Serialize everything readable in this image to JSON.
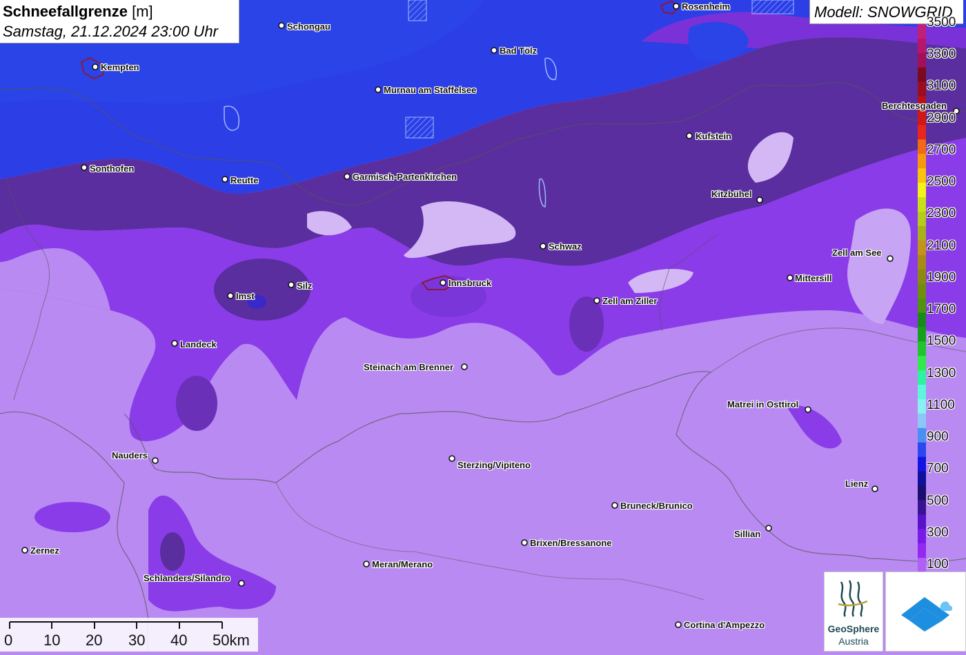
{
  "title": {
    "main": "Schneefallgrenze",
    "unit": "[m]",
    "date": "Samstag, 21.12.2024 23:00 Uhr"
  },
  "model_label": "Modell: SNOWGRID",
  "cities": [
    {
      "name": "Schongau",
      "label": "Schongau"
    },
    {
      "name": "Rosenheim",
      "label": "Rosenheim"
    },
    {
      "name": "Kempten",
      "label": "Kempten"
    },
    {
      "name": "Bad Tölz",
      "label": "Bad Tölz"
    },
    {
      "name": "Murnau am Staffelsee",
      "label": "Murnau am Staffelsee"
    },
    {
      "name": "Berchtesgaden",
      "label": "Berchtesgaden"
    },
    {
      "name": "Kufstein",
      "label": "Kufstein"
    },
    {
      "name": "Sonthofen",
      "label": "Sonthofen"
    },
    {
      "name": "Reutte",
      "label": "Reutte"
    },
    {
      "name": "Garmisch-Partenkirchen",
      "label": "Garmisch-Partenkirchen"
    },
    {
      "name": "Kitzbühel",
      "label": "Kitzbühel"
    },
    {
      "name": "Schwaz",
      "label": "Schwaz"
    },
    {
      "name": "Zell am See",
      "label": "Zell am See"
    },
    {
      "name": "Imst",
      "label": "Imst"
    },
    {
      "name": "Silz",
      "label": "Silz"
    },
    {
      "name": "Innsbruck",
      "label": "Innsbruck"
    },
    {
      "name": "Mittersill",
      "label": "Mittersill"
    },
    {
      "name": "Zell am Ziller",
      "label": "Zell am Ziller"
    },
    {
      "name": "Landeck",
      "label": "Landeck"
    },
    {
      "name": "Steinach am Brenner",
      "label": "Steinach am Brenner"
    },
    {
      "name": "Matrei in Osttirol",
      "label": "Matrei in Osttirol"
    },
    {
      "name": "Nauders",
      "label": "Nauders"
    },
    {
      "name": "Sterzing/Vipiteno",
      "label": "Sterzing/Vipiteno"
    },
    {
      "name": "Lienz",
      "label": "Lienz"
    },
    {
      "name": "Bruneck/Brunico",
      "label": "Bruneck/Brunico"
    },
    {
      "name": "Sillian",
      "label": "Sillian"
    },
    {
      "name": "Zernez",
      "label": "Zernez"
    },
    {
      "name": "Brixen/Bressanone",
      "label": "Brixen/Bressanone"
    },
    {
      "name": "Meran/Merano",
      "label": "Meran/Merano"
    },
    {
      "name": "Schlanders/Silandro",
      "label": "Schlanders/Silandro"
    },
    {
      "name": "Cortina d'Ampezzo",
      "label": "Cortina d'Ampezzo"
    }
  ],
  "legend": {
    "labels": [
      "3500",
      "3300",
      "3100",
      "2900",
      "2700",
      "2500",
      "2300",
      "2100",
      "1900",
      "1700",
      "1500",
      "1300",
      "1100",
      "900",
      "700",
      "500",
      "300",
      "100"
    ],
    "colors": [
      "#c0207a",
      "#b8156d",
      "#a3105a",
      "#7c0a1e",
      "#9b0d1f",
      "#b6121c",
      "#d01818",
      "#e8261c",
      "#f26a14",
      "#f59a0d",
      "#f7c60c",
      "#f5f21a",
      "#c6e01a",
      "#b5cc1a",
      "#a8b01a",
      "#c2941b",
      "#a98a16",
      "#8c8a10",
      "#6f8e0c",
      "#4e9410",
      "#1a8a1a",
      "#17a01e",
      "#22c42e",
      "#33e84a",
      "#2ef2a0",
      "#5ef5dc",
      "#8af0f2",
      "#8cc8f5",
      "#4a90f0",
      "#2a48ee",
      "#1414e0",
      "#10109c",
      "#1c0e6e",
      "#3a1490",
      "#5a12c8",
      "#7a1ae8",
      "#9428f0",
      "#b060f5"
    ],
    "unit_range": [
      100,
      3500
    ]
  },
  "scale_bar": {
    "labels": [
      "0",
      "10",
      "20",
      "30",
      "40",
      "50km"
    ]
  },
  "logos": {
    "geosphere_line1": "GeoSphere",
    "geosphere_line2": "Austria"
  },
  "colors": {
    "low_blue": "#2b3fe8",
    "mid_blue": "#3a2ad8",
    "dark_violet": "#5a2e9e",
    "violet": "#8a3ce8",
    "light_violet": "#b98af2",
    "pale_violet": "#d4b8f5"
  }
}
